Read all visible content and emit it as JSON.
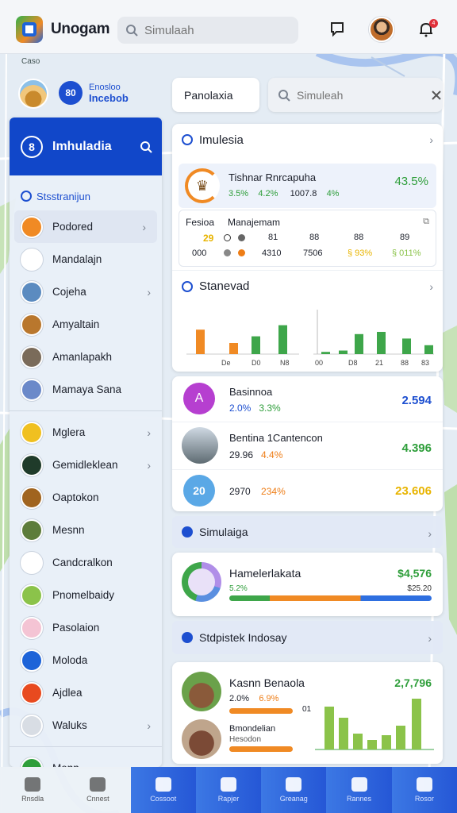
{
  "app": {
    "name": "Unogam"
  },
  "top_search": {
    "placeholder": "Simulaah"
  },
  "map_label": "Caso",
  "profile": {
    "badge": "80",
    "line1": "Enosloo",
    "line2": "Incebob"
  },
  "sidebar": {
    "header_title": "Imhuladia",
    "header_icon": "8",
    "section_title": "Stsstranijun",
    "items_group1": [
      {
        "label": "Podored",
        "thumb_color": "#f08a24",
        "icon": "sun-icon",
        "chevron": true,
        "active": true
      },
      {
        "label": "Mandalajn",
        "thumb_color": "#ffffff",
        "icon": "person-icon",
        "chevron": false
      },
      {
        "label": "Cojeha",
        "thumb_color": "#5b8bc0",
        "icon": "building-icon",
        "chevron": true
      },
      {
        "label": "Amyaltain",
        "thumb_color": "#b9772d",
        "icon": "landscape-icon",
        "chevron": false
      },
      {
        "label": "Amanlapakh",
        "thumb_color": "#7a6b5a",
        "icon": "temple-icon",
        "chevron": false
      },
      {
        "label": "Mamaya Sana",
        "thumb_color": "#6b89c9",
        "icon": "document-icon",
        "chevron": false
      }
    ],
    "items_group2": [
      {
        "label": "Mglera",
        "thumb_color": "#f0c020",
        "icon": "car-icon",
        "chevron": true
      },
      {
        "label": "Gemidleklean",
        "thumb_color": "#1f3b2a",
        "icon": "leaf-icon",
        "chevron": true
      },
      {
        "label": "Oaptokon",
        "thumb_color": "#a0641f",
        "icon": "temple-icon",
        "chevron": false
      },
      {
        "label": "Mesnn",
        "thumb_color": "#5d7c3a",
        "icon": "map-icon",
        "chevron": false
      },
      {
        "label": "Candcralkon",
        "thumb_color": "#ffffff",
        "icon": "grid-icon",
        "chevron": false
      },
      {
        "label": "Pnomelbaidy",
        "thumb_color": "#8bc34a",
        "icon": "list-icon",
        "chevron": false
      },
      {
        "label": "Pasolaion",
        "thumb_color": "#f4c4d4",
        "icon": "flower-icon",
        "chevron": false
      },
      {
        "label": "Moloda",
        "thumb_color": "#1d63d8",
        "icon": "infinity-icon",
        "chevron": false
      },
      {
        "label": "Ajdlea",
        "thumb_color": "#e84a1f",
        "icon": "target-icon",
        "chevron": false
      },
      {
        "label": "Waluks",
        "thumb_color": "#d8dde4",
        "icon": "close-box-icon",
        "chevron": true
      }
    ],
    "footer_item": {
      "label": "Menn",
      "thumb_color": "#2e9e3a",
      "icon": "g-icon",
      "chevron": true
    }
  },
  "pill_button": "Panolaxia",
  "right_search": {
    "placeholder": "Simuleah"
  },
  "card_immulesia": {
    "title": "Imulesia",
    "row1": {
      "title": "Tishnar Rnrcapuha",
      "stat1": "3.5%",
      "stat2": "4.2%",
      "stat3": "1007.8",
      "stat4": "4%",
      "value": "43.5%"
    },
    "table": {
      "col1": "Fesioa",
      "col2": "Manajemam",
      "row1": [
        "29",
        "81",
        "88",
        "88",
        "89"
      ],
      "row2": [
        "000",
        "4310",
        "7506",
        "§ 93%",
        "§ 011%"
      ]
    }
  },
  "card_stanevad": {
    "title": "Stanevad",
    "x_ticks_left": [
      "De",
      "D0",
      "N8"
    ],
    "x_ticks_right": [
      "00",
      "D8",
      "21",
      "88",
      "83"
    ]
  },
  "card_list": {
    "rows": [
      {
        "title": "Basinnoa",
        "stat1": "2.0%",
        "stat2": "3.3%",
        "value": "2.594",
        "badge": "A"
      },
      {
        "title": "Bentina 1Cantencon",
        "stat1": "29.96",
        "stat2": "4.4%",
        "value": "4.396"
      },
      {
        "title": "",
        "stat1": "2970",
        "stat2": "234%",
        "value": "23.606",
        "badge": "20"
      }
    ]
  },
  "strip_simulaiga": {
    "label": "Simulaiga"
  },
  "card_hamel": {
    "title": "Hamelerlakata",
    "percent": "5.2%",
    "value": "$4,576",
    "subvalue": "$25.20"
  },
  "strip_stdpistek": {
    "label": "Stdpistek Indosay"
  },
  "card_kasnn": {
    "title": "Kasnn Benaola",
    "stat1": "2.0%",
    "stat2": "6.9%",
    "value": "2,7,796",
    "sub_number": "01",
    "sub_title1": "Bmondelian",
    "sub_title2": "Hesodon"
  },
  "bottom_nav": [
    {
      "label": "Rnsdla",
      "icon": "tree-icon"
    },
    {
      "label": "Cnnest",
      "icon": "chart-icon"
    },
    {
      "label": "Cossoot",
      "icon": "receipt-icon"
    },
    {
      "label": "Rapjer",
      "icon": "home-icon"
    },
    {
      "label": "Greanag",
      "icon": "grid-icon"
    },
    {
      "label": "Rannes",
      "icon": "user-icon"
    },
    {
      "label": "Rosor",
      "icon": "puzzle-icon"
    }
  ],
  "colors": {
    "primary_blue": "#1147c9",
    "green": "#2e9e3a",
    "orange": "#ee7d16",
    "yellow": "#e8b400"
  },
  "chart_data": {
    "type": "bar",
    "series": [
      {
        "values": [
          0.55,
          0.25,
          0.4,
          0.65,
          0.05,
          0.08,
          0.45,
          0.5,
          0.35,
          0.2
        ]
      }
    ],
    "colors_order": [
      "#f08a24",
      "#f08a24",
      "#3ea64a",
      "#3ea64a",
      "#3ea64a",
      "#3ea64a",
      "#3ea64a",
      "#3ea64a",
      "#3ea64a",
      "#3ea64a"
    ],
    "ylim": [
      0,
      1
    ]
  }
}
